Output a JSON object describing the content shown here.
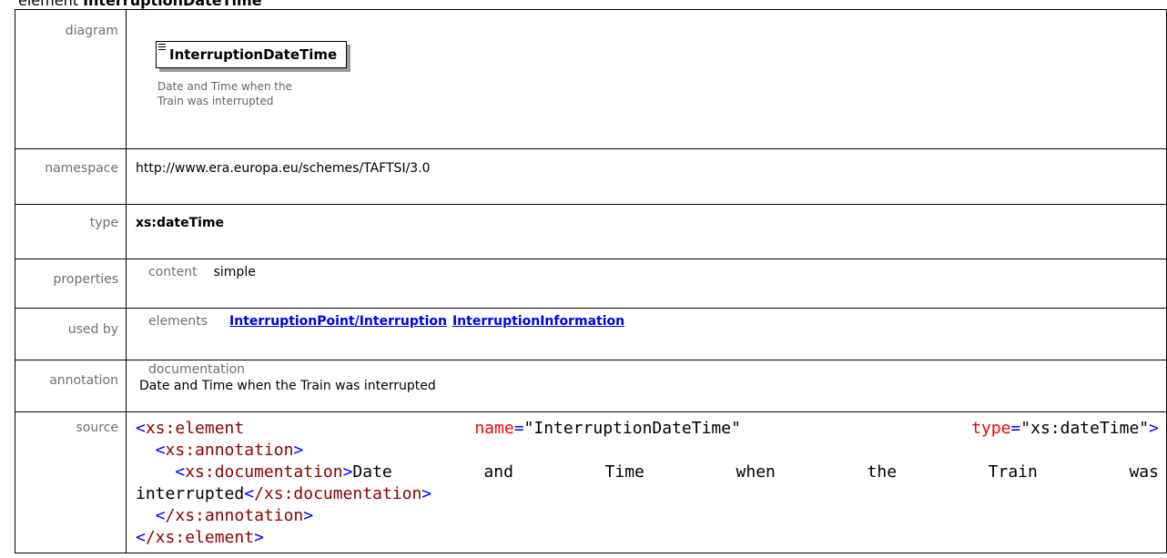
{
  "heading": {
    "prefix": "element ",
    "name": "InterruptionDateTime"
  },
  "rows": {
    "diagram": {
      "label": "diagram",
      "box_name": "InterruptionDateTime",
      "box_doc": "Date and Time when the Train was interrupted"
    },
    "namespace": {
      "label": "namespace",
      "value": "http://www.era.europa.eu/schemes/TAFTSI/3.0"
    },
    "type": {
      "label": "type",
      "value": "xs:dateTime"
    },
    "properties": {
      "label": "properties",
      "sub_label": "content",
      "value": "simple"
    },
    "used_by": {
      "label": "used by",
      "sub_label": "elements",
      "links": [
        "InterruptionPoint/Interruption",
        "InterruptionInformation"
      ]
    },
    "annotation": {
      "label": "annotation",
      "sub_label": "documentation",
      "value": "Date and Time when the Train was interrupted"
    },
    "source": {
      "label": "source",
      "open_tag": "xs:element",
      "attr1_name": "name",
      "attr1_value": "\"InterruptionDateTime\"",
      "attr2_name": "type",
      "attr2_value": "\"xs:dateTime\"",
      "annotation_tag": "xs:annotation",
      "documentation_tag": "xs:documentation",
      "doc_words": [
        "Date",
        "and",
        "Time",
        "when",
        "the",
        "Train",
        "was"
      ],
      "doc_last": "interrupted",
      "close_documentation": "/xs:documentation",
      "close_annotation": "/xs:annotation",
      "close_element": "/xs:element"
    }
  },
  "colors": {
    "tag": "#8b0000",
    "attr": "#ff0000",
    "punct": "#0000ff",
    "link": "#0000ee"
  }
}
